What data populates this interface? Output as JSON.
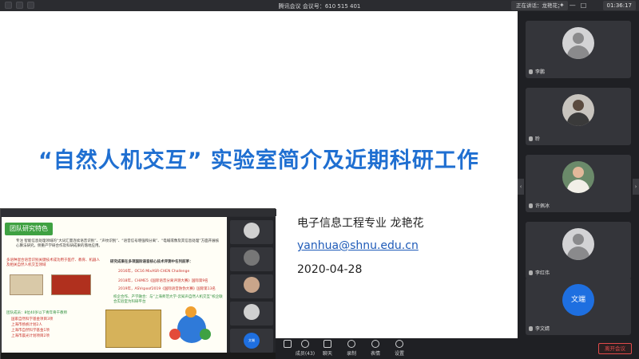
{
  "topbar": {
    "meeting_title": "腾讯会议  会议号：610 515 401",
    "speaking": "正在讲话：龙艳花；",
    "clock": "01:36:17"
  },
  "slide": {
    "title": "“自然人机交互”  实验室简介及近期科研工作",
    "author": "电子信息工程专业  龙艳花",
    "email": "yanhua@shnu.edu.cn",
    "date": "2020-04-28"
  },
  "nested": {
    "team_title": "团队研究特色",
    "focus_intro": "专注 智能信息处理领域的“大词汇量连续语音识别”、“声纹识别”、“语音信号增强和分离”、“电喊或像及其信息处理”方面开展核心算法研究，侧重产学研合作及科研成果的落地应用。",
    "scenario": "多语种混合语音识别关键技术成功用于医疗、教育、机器人及相关自然人机交互领域",
    "results_title": "研究成果在多项国际语音核心技术评测中名列前茅：",
    "r1": "2016年，OC16 MixASR-CHEN Challenge",
    "r2": "2018年，CHiME5《国际语音分离评测大赛》国际第9名",
    "r3": "2019年，ASVspoof2019《国际语音防伪大赛》国际第13名",
    "coop": "校企合作、产学融合：与“上海师范大学-云知声自然人机交互”校企联合实验室为科研平台",
    "team_size": "团队成员：8位40岁以下青年骨干教师",
    "grant1": "国家自然科学基金项目3项",
    "grant2": "上海市扬帆计划2人",
    "grant3": "上海市自然科学基金1项",
    "grant4": "上海市晨光计划项目2项",
    "side_label": "文端"
  },
  "participants": [
    {
      "name": "李鹏",
      "type": "default"
    },
    {
      "name": "聆",
      "type": "photo"
    },
    {
      "name": "许佩冰",
      "type": "photo"
    },
    {
      "name": "李红伟",
      "type": "default"
    },
    {
      "name": "李文婧",
      "type": "initials",
      "initials": "文端"
    }
  ],
  "toolbar": {
    "items": [
      "",
      "成员(43)",
      "聊天",
      "录制",
      "表情",
      "设置"
    ],
    "leave": "离开会议"
  }
}
